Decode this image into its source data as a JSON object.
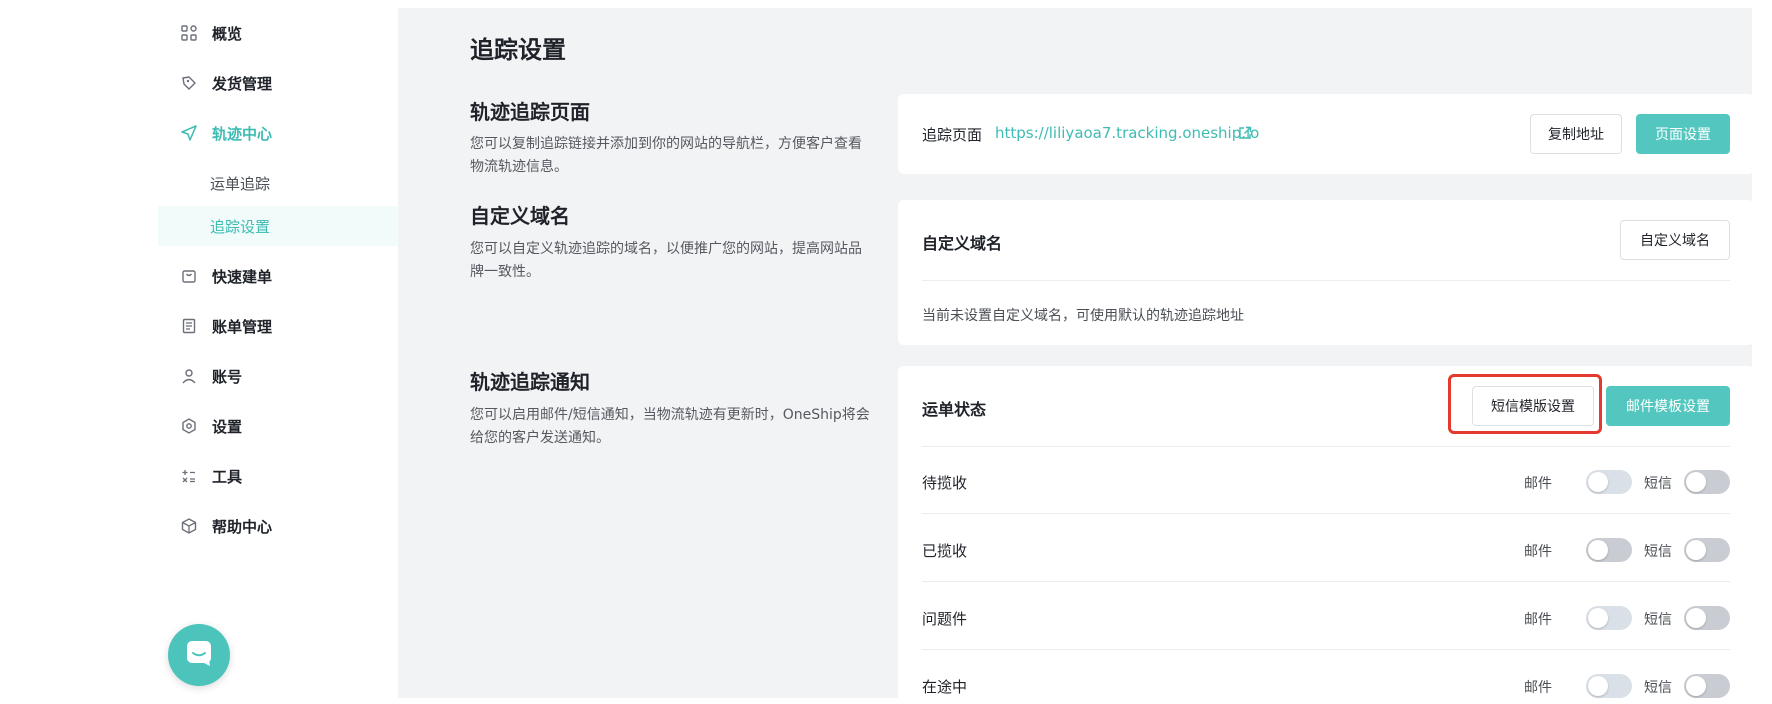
{
  "sidebar": {
    "items": [
      {
        "label": "概览",
        "icon": "grid-icon"
      },
      {
        "label": "发货管理",
        "icon": "delivery-icon"
      },
      {
        "label": "轨迹中心",
        "icon": "send-icon"
      },
      {
        "label": "快速建单",
        "icon": "bag-icon"
      },
      {
        "label": "账单管理",
        "icon": "bill-icon"
      },
      {
        "label": "账号",
        "icon": "user-icon"
      },
      {
        "label": "设置",
        "icon": "settings-icon"
      },
      {
        "label": "工具",
        "icon": "tools-icon"
      },
      {
        "label": "帮助中心",
        "icon": "box-icon"
      }
    ],
    "sub_items": [
      {
        "label": "运单追踪"
      },
      {
        "label": "追踪设置"
      }
    ],
    "chat_icon": "chat-icon"
  },
  "main": {
    "title": "追踪设置",
    "tracking_page": {
      "title": "轨迹追踪页面",
      "desc": "您可以复制追踪链接并添加到你的网站的导航栏，方便客户查看物流轨迹信息。",
      "label": "追踪页面",
      "url": "https://liliyaoa7.tracking.oneship.io",
      "copy_btn": "复制地址",
      "settings_btn": "页面设置"
    },
    "custom_domain": {
      "title": "自定义域名",
      "desc": "您可以自定义轨迹追踪的域名，以便推广您的网站，提高网站品牌一致性。",
      "card_title": "自定义域名",
      "btn": "自定义域名",
      "note": "当前未设置自定义域名，可使用默认的轨迹追踪地址"
    },
    "notification": {
      "title": "轨迹追踪通知",
      "desc": "您可以启用邮件/短信通知，当物流轨迹有更新时，OneShip将会给您的客户发送通知。",
      "card_title": "运单状态",
      "sms_btn": "短信模版设置",
      "email_btn": "邮件模板设置",
      "email_label": "邮件",
      "sms_label": "短信",
      "rows": [
        {
          "label": "待揽收",
          "email_on": false,
          "sms_on": false
        },
        {
          "label": "已揽收",
          "email_on": false,
          "sms_on": false
        },
        {
          "label": "问题件",
          "email_on": false,
          "sms_on": false
        },
        {
          "label": "在途中",
          "email_on": false,
          "sms_on": false
        }
      ]
    }
  },
  "colors": {
    "accent": "#3ebcb3",
    "highlight": "#e5392f"
  }
}
